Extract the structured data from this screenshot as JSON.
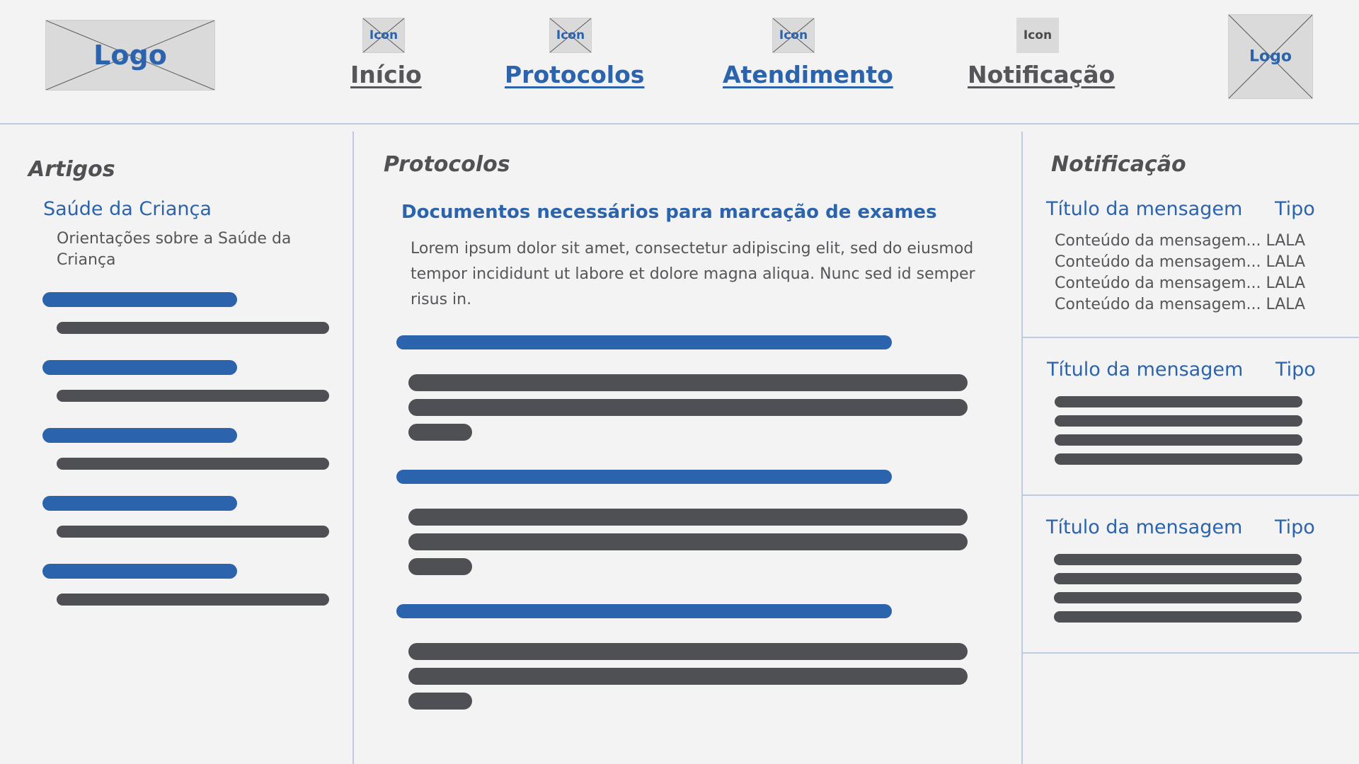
{
  "header": {
    "logo_left": "Logo",
    "logo_right": "Logo",
    "nav": [
      {
        "label": "Início",
        "icon_label": "Icon",
        "color": "#55555a"
      },
      {
        "label": "Protocolos",
        "icon_label": "Icon",
        "color": "#2b63ad"
      },
      {
        "label": "Atendimento",
        "icon_label": "Icon",
        "color": "#2b63ad"
      },
      {
        "label": "Notificação",
        "icon_label": "Icon",
        "color": "#55555a"
      }
    ]
  },
  "articles": {
    "title": "Artigos",
    "link": "Saúde da Criança",
    "description": "Orientações sobre a Saúde da Criança"
  },
  "protocols": {
    "title": "Protocolos",
    "link": "Documentos necessários para marcação de exames",
    "body": "Lorem ipsum dolor sit amet, consectetur adipiscing elit, sed do eiusmod tempor incididunt ut labore et dolore magna aliqua. Nunc sed id semper risus in."
  },
  "notifications": {
    "title": "Notificação",
    "cards": [
      {
        "title": "Título da mensagem",
        "type": "Tipo",
        "rows": [
          "Conteúdo da mensagem... LALA",
          "Conteúdo da mensagem... LALA",
          "Conteúdo da mensagem... LALA",
          "Conteúdo da mensagem... LALA"
        ]
      },
      {
        "title": "Título da mensagem",
        "type": "Tipo"
      },
      {
        "title": "Título da mensagem",
        "type": "Tipo"
      }
    ]
  },
  "colors": {
    "accent": "#2b63ad",
    "text": "#55555a",
    "bar_dark": "#4f5054",
    "background": "#f3f3f3"
  }
}
